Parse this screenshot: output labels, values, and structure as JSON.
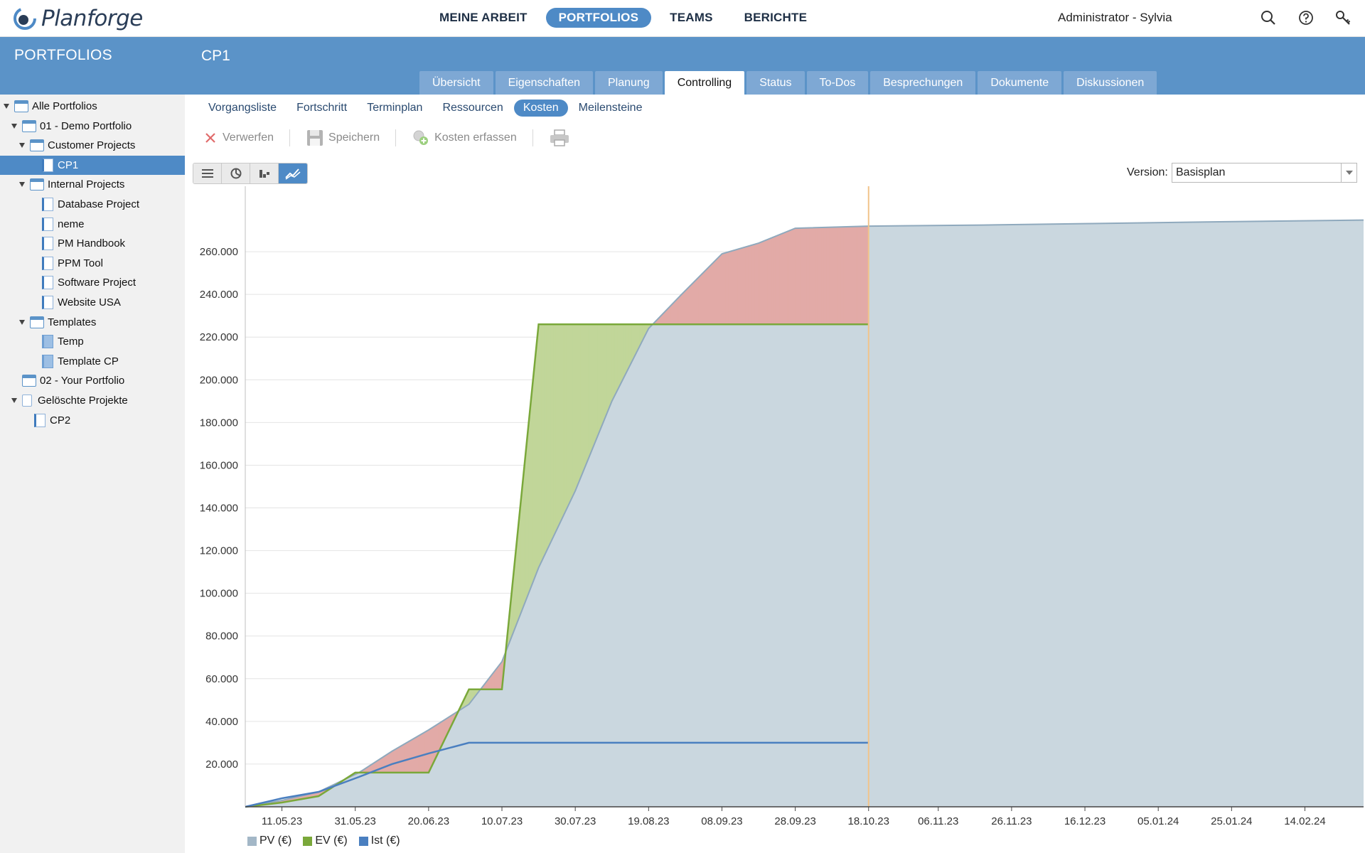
{
  "app": {
    "name": "Planforge"
  },
  "topnav": {
    "items": [
      {
        "label": "MEINE ARBEIT",
        "active": false
      },
      {
        "label": "PORTFOLIOS",
        "active": true
      },
      {
        "label": "TEAMS",
        "active": false
      },
      {
        "label": "BERICHTE",
        "active": false
      }
    ],
    "user": "Administrator - Sylvia",
    "icons": [
      "search-icon",
      "help-icon",
      "key-icon"
    ]
  },
  "sidebar": {
    "title": "PORTFOLIOS",
    "items": [
      {
        "label": "Alle Portfolios",
        "level": 0,
        "icon": "portfolio",
        "expanded": true
      },
      {
        "label": "01 - Demo Portfolio",
        "level": 1,
        "icon": "portfolio",
        "expanded": true
      },
      {
        "label": "Customer Projects",
        "level": 2,
        "icon": "portfolio",
        "expanded": true
      },
      {
        "label": "CP1",
        "level": 3,
        "icon": "project",
        "selected": true
      },
      {
        "label": "Internal Projects",
        "level": 2,
        "icon": "portfolio",
        "expanded": true
      },
      {
        "label": "Database Project",
        "level": 3,
        "icon": "project"
      },
      {
        "label": "neme",
        "level": 3,
        "icon": "project"
      },
      {
        "label": "PM Handbook",
        "level": 3,
        "icon": "project"
      },
      {
        "label": "PPM Tool",
        "level": 3,
        "icon": "project"
      },
      {
        "label": "Software Project",
        "level": 3,
        "icon": "project"
      },
      {
        "label": "Website USA",
        "level": 3,
        "icon": "project"
      },
      {
        "label": "Templates",
        "level": 2,
        "icon": "portfolio",
        "expanded": true
      },
      {
        "label": "Temp",
        "level": 3,
        "icon": "template"
      },
      {
        "label": "Template CP",
        "level": 3,
        "icon": "template"
      },
      {
        "label": "02 - Your Portfolio",
        "level": 1,
        "icon": "portfolio"
      },
      {
        "label": "Gelöschte Projekte",
        "level": 1,
        "icon": "trash",
        "expanded": true
      },
      {
        "label": "CP2",
        "level": 2,
        "icon": "deleted-project"
      }
    ]
  },
  "project": {
    "title": "CP1",
    "tabs": [
      {
        "label": "Übersicht",
        "active": false
      },
      {
        "label": "Eigenschaften",
        "active": false
      },
      {
        "label": "Planung",
        "active": false
      },
      {
        "label": "Controlling",
        "active": true
      },
      {
        "label": "Status",
        "active": false
      },
      {
        "label": "To-Dos",
        "active": false
      },
      {
        "label": "Besprechungen",
        "active": false
      },
      {
        "label": "Dokumente",
        "active": false
      },
      {
        "label": "Diskussionen",
        "active": false
      }
    ],
    "subtabs": [
      {
        "label": "Vorgangsliste",
        "active": false
      },
      {
        "label": "Fortschritt",
        "active": false
      },
      {
        "label": "Terminplan",
        "active": false
      },
      {
        "label": "Ressourcen",
        "active": false
      },
      {
        "label": "Kosten",
        "active": true
      },
      {
        "label": "Meilensteine",
        "active": false
      }
    ]
  },
  "toolbar": {
    "discard_label": "Verwerfen",
    "save_label": "Speichern",
    "record_costs_label": "Kosten erfassen",
    "print_icon": "printer-icon"
  },
  "views": [
    {
      "icon": "list-icon",
      "active": false
    },
    {
      "icon": "pie-icon",
      "active": false
    },
    {
      "icon": "bar-icon",
      "active": false
    },
    {
      "icon": "line-chart-icon",
      "active": true
    }
  ],
  "version": {
    "label": "Version:",
    "value": "Basisplan"
  },
  "colors": {
    "pv": "#cad7df",
    "pv_line": "#8fa9bd",
    "ev": "#7aa83a",
    "ev_fill": "#c1d699",
    "ist": "#4a7fc0",
    "overrun": "#e2aaa7",
    "today": "#f1c48a",
    "accent": "#4e8ac6"
  },
  "chart_data": {
    "type": "area",
    "x_ticks": [
      "11.05.23",
      "31.05.23",
      "20.06.23",
      "10.07.23",
      "30.07.23",
      "19.08.23",
      "08.09.23",
      "28.09.23",
      "18.10.23",
      "06.11.23",
      "26.11.23",
      "16.12.23",
      "05.01.24",
      "25.01.24",
      "14.02.24"
    ],
    "y_ticks": [
      20000,
      40000,
      60000,
      80000,
      100000,
      120000,
      140000,
      160000,
      180000,
      200000,
      220000,
      240000,
      260000
    ],
    "y_tick_labels": [
      "20.000",
      "40.000",
      "60.000",
      "80.000",
      "100.000",
      "120.000",
      "140.000",
      "160.000",
      "180.000",
      "200.000",
      "220.000",
      "240.000",
      "260.000"
    ],
    "ylim": [
      0,
      288000
    ],
    "xlim": [
      "2023-05-01",
      "2024-03-01"
    ],
    "today": "2023-10-18",
    "series": [
      {
        "name": "PV (€)",
        "points": [
          [
            "2023-05-01",
            0
          ],
          [
            "2023-05-11",
            3000
          ],
          [
            "2023-05-21",
            7000
          ],
          [
            "2023-06-01",
            16000
          ],
          [
            "2023-06-10",
            26000
          ],
          [
            "2023-06-20",
            36000
          ],
          [
            "2023-07-01",
            48000
          ],
          [
            "2023-07-10",
            68000
          ],
          [
            "2023-07-20",
            112000
          ],
          [
            "2023-07-30",
            148000
          ],
          [
            "2023-08-09",
            190000
          ],
          [
            "2023-08-19",
            224000
          ],
          [
            "2023-08-28",
            240000
          ],
          [
            "2023-09-08",
            259000
          ],
          [
            "2023-09-18",
            264000
          ],
          [
            "2023-09-28",
            271000
          ],
          [
            "2023-10-18",
            272000
          ],
          [
            "2023-11-18",
            272500
          ],
          [
            "2023-12-18",
            273200
          ],
          [
            "2024-01-18",
            273900
          ],
          [
            "2024-03-01",
            274800
          ]
        ]
      },
      {
        "name": "EV (€)",
        "points": [
          [
            "2023-05-01",
            0
          ],
          [
            "2023-05-11",
            2000
          ],
          [
            "2023-05-21",
            5000
          ],
          [
            "2023-05-31",
            16000
          ],
          [
            "2023-06-20",
            16000
          ],
          [
            "2023-07-01",
            55000
          ],
          [
            "2023-07-10",
            55000
          ],
          [
            "2023-07-20",
            226000
          ],
          [
            "2023-10-18",
            226000
          ]
        ]
      },
      {
        "name": "Ist (€)",
        "points": [
          [
            "2023-05-01",
            0
          ],
          [
            "2023-05-11",
            4000
          ],
          [
            "2023-05-21",
            7000
          ],
          [
            "2023-06-01",
            14000
          ],
          [
            "2023-06-10",
            20000
          ],
          [
            "2023-06-20",
            25000
          ],
          [
            "2023-07-01",
            30000
          ],
          [
            "2023-10-18",
            30000
          ]
        ]
      }
    ]
  },
  "legend": [
    {
      "label": "PV (€)",
      "color": "#a3b7c7"
    },
    {
      "label": "EV (€)",
      "color": "#7aa83a"
    },
    {
      "label": "Ist (€)",
      "color": "#4a7fc0"
    }
  ]
}
